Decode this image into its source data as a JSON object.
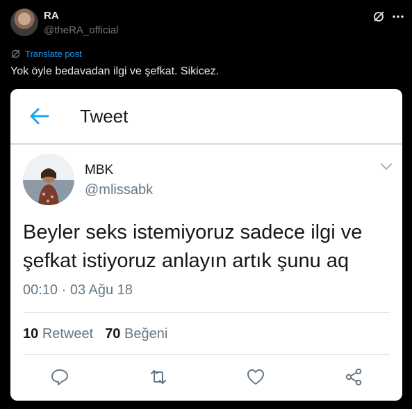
{
  "post": {
    "author_name": "RA",
    "author_handle": "@theRA_official",
    "translate_label": "Translate post",
    "text": "Yok öyle bedavadan ilgi ve şefkat. Sikicez."
  },
  "quoted": {
    "header_title": "Tweet",
    "name": "MBK",
    "handle": "@mlissabk",
    "text": "Beyler seks istemiyoruz sadece ilgi ve şefkat istiyoruz anlayın artık şunu aq",
    "timestamp": "00:10 · 03 Ağu 18",
    "retweet_count": "10",
    "retweet_label": "Retweet",
    "like_count": "70",
    "like_label": "Beğeni"
  },
  "colors": {
    "background": "#000000",
    "accent": "#1d9bf0",
    "card_bg": "#ffffff",
    "muted": "#71767b"
  },
  "icons": [
    "grok-icon",
    "more-icon",
    "translate-icon",
    "back-arrow-icon",
    "chevron-down-icon",
    "reply-icon",
    "retweet-icon",
    "like-icon",
    "share-icon"
  ]
}
